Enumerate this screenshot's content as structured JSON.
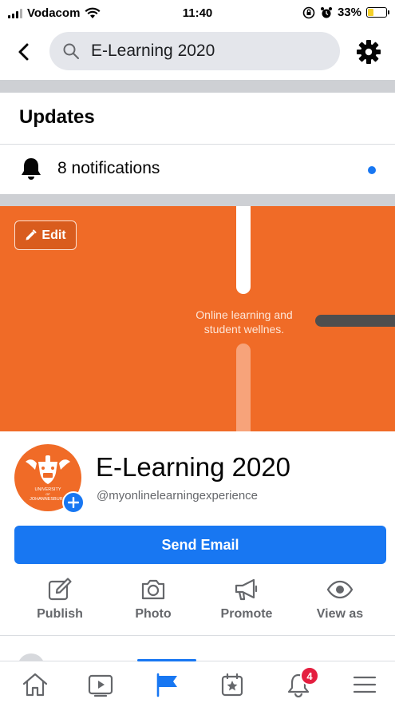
{
  "status_bar": {
    "carrier": "Vodacom",
    "time": "11:40",
    "battery": "33%",
    "battery_level": 0.33,
    "icons": [
      "signal-icon",
      "wifi-icon",
      "rotation-lock-icon",
      "alarm-icon",
      "battery-icon"
    ]
  },
  "search": {
    "query": "E-Learning 2020",
    "icons": [
      "back-arrow-icon",
      "search-icon",
      "gear-icon"
    ]
  },
  "updates": {
    "title": "Updates",
    "notifications_label": "8 notifications",
    "unread": true
  },
  "cover": {
    "edit_label": "Edit",
    "text": "Online learning and student wellnes.",
    "color": "#f06b27"
  },
  "profile": {
    "name": "E-Learning 2020",
    "handle": "@myonlinelearningexperience",
    "logo_lines": [
      "UNIVERSITY",
      "OF",
      "JOHANNESBURG"
    ]
  },
  "primary_action": {
    "label": "Send Email",
    "color": "#1877f2"
  },
  "actions": [
    {
      "label": "Publish",
      "icon": "pencil-square-icon"
    },
    {
      "label": "Photo",
      "icon": "camera-icon"
    },
    {
      "label": "Promote",
      "icon": "megaphone-icon"
    },
    {
      "label": "View as",
      "icon": "eye-icon"
    }
  ],
  "tabs": [
    {
      "name": "home",
      "icon": "home-icon"
    },
    {
      "name": "watch",
      "icon": "video-icon"
    },
    {
      "name": "pages",
      "icon": "flag-icon",
      "active": true
    },
    {
      "name": "feeds",
      "icon": "star-calendar-icon"
    },
    {
      "name": "notifications",
      "icon": "bell-icon",
      "badge": "4"
    },
    {
      "name": "menu",
      "icon": "hamburger-menu-icon"
    }
  ]
}
